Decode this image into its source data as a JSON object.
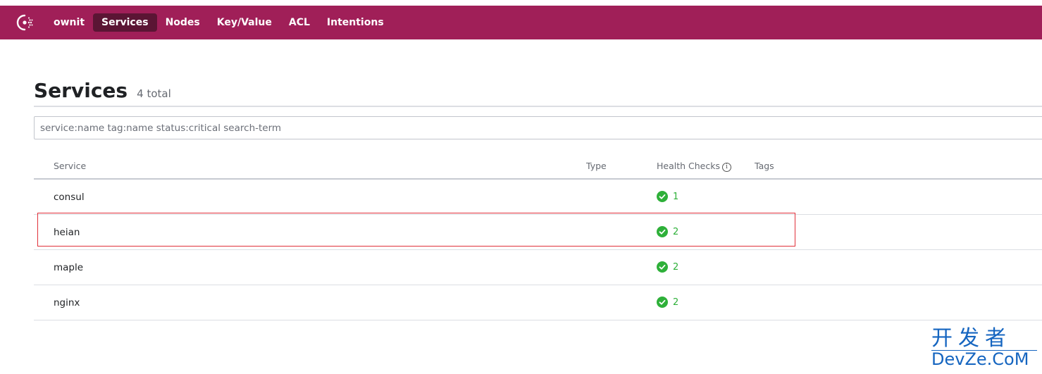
{
  "nav": {
    "logo": "consul-logo-icon",
    "datacenter": "ownit",
    "items": [
      {
        "label": "Services",
        "active": true
      },
      {
        "label": "Nodes",
        "active": false
      },
      {
        "label": "Key/Value",
        "active": false
      },
      {
        "label": "ACL",
        "active": false
      },
      {
        "label": "Intentions",
        "active": false
      }
    ]
  },
  "page": {
    "title": "Services",
    "count": "4 total"
  },
  "search": {
    "placeholder": "service:name tag:name status:critical search-term",
    "value": ""
  },
  "table": {
    "headers": {
      "service": "Service",
      "type": "Type",
      "health": "Health Checks",
      "tags": "Tags"
    },
    "rows": [
      {
        "name": "consul",
        "type": "",
        "passing": "1",
        "tags": ""
      },
      {
        "name": "heian",
        "type": "",
        "passing": "2",
        "tags": "",
        "highlighted": true
      },
      {
        "name": "maple",
        "type": "",
        "passing": "2",
        "tags": ""
      },
      {
        "name": "nginx",
        "type": "",
        "passing": "2",
        "tags": ""
      }
    ]
  },
  "colors": {
    "nav_bg": "#a01f58",
    "nav_active": "#5b1534",
    "passing": "#2eb039",
    "highlight": "#e0303a"
  },
  "watermark": {
    "line1": "开发者",
    "line2": "DevZe.CoM"
  }
}
